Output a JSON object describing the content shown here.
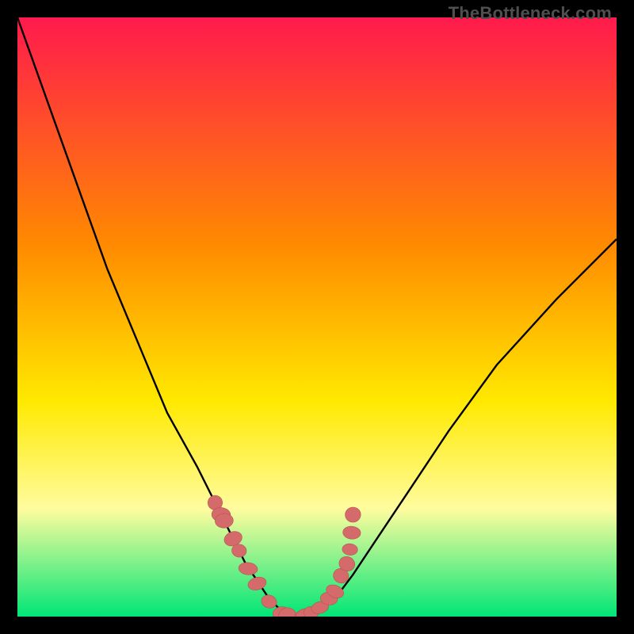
{
  "watermark": "TheBottleneck.com",
  "colors": {
    "frame": "#000000",
    "gradient_top": "#ff1a4d",
    "gradient_mid1": "#ff8a00",
    "gradient_mid2": "#ffe900",
    "gradient_mid3": "#fffc9e",
    "gradient_bottom": "#00e676",
    "curve": "#000000",
    "marker_fill": "#d56a6a",
    "marker_stroke": "#b45454"
  },
  "chart_data": {
    "type": "line",
    "title": "",
    "xlabel": "",
    "ylabel": "",
    "xlim": [
      0,
      100
    ],
    "ylim": [
      0,
      100
    ],
    "grid": false,
    "legend": false,
    "series": [
      {
        "name": "bottleneck-curve",
        "x": [
          0,
          5,
          10,
          15,
          20,
          25,
          30,
          33,
          36,
          38,
          40,
          42,
          44,
          46,
          48,
          50,
          53,
          56,
          60,
          66,
          72,
          80,
          90,
          100
        ],
        "y": [
          100,
          86,
          72,
          58,
          46,
          34,
          25,
          19,
          13,
          9,
          6,
          3,
          1,
          0.2,
          0.2,
          1,
          3,
          7,
          13,
          22,
          31,
          42,
          53,
          63
        ]
      }
    ],
    "markers_left": {
      "name": "left-cluster",
      "x": [
        33,
        34,
        34.5,
        36,
        37,
        38.5,
        40,
        42,
        44,
        45
      ],
      "y": [
        19,
        17,
        16,
        13,
        11,
        8,
        5.5,
        2.5,
        0.6,
        0.3
      ]
    },
    "markers_right": {
      "name": "right-cluster",
      "x": [
        48,
        49,
        50.5,
        52,
        53,
        54,
        55,
        55.5,
        55.8,
        56
      ],
      "y": [
        0.3,
        0.6,
        1.5,
        3,
        4.2,
        6.8,
        8.8,
        11.2,
        14,
        17
      ]
    },
    "trough_band": {
      "x0": 44,
      "x1": 49,
      "y": 0.15,
      "thickness": 1.2
    }
  }
}
